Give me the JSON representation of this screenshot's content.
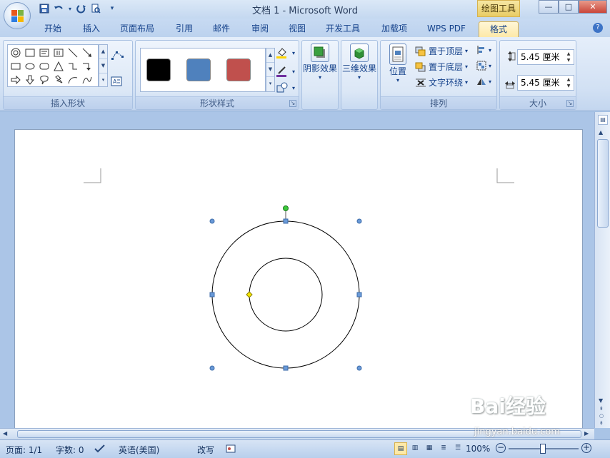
{
  "titlebar": {
    "title": "文档 1 - Microsoft Word",
    "context_tab": "绘图工具",
    "minimize": "—",
    "maximize": "□",
    "close": "✕"
  },
  "qat": {
    "save_icon": "save-icon",
    "undo_icon": "undo-icon",
    "redo_icon": "redo-icon",
    "print_preview_icon": "print-preview-icon",
    "customize_icon": "chevron-down-icon"
  },
  "tabs": [
    {
      "label": "开始"
    },
    {
      "label": "插入"
    },
    {
      "label": "页面布局"
    },
    {
      "label": "引用"
    },
    {
      "label": "邮件"
    },
    {
      "label": "审阅"
    },
    {
      "label": "视图"
    },
    {
      "label": "开发工具"
    },
    {
      "label": "加载项"
    },
    {
      "label": "WPS PDF"
    },
    {
      "label": "格式"
    }
  ],
  "active_tab": "格式",
  "ribbon": {
    "insert_shapes": {
      "label": "插入形状"
    },
    "shape_styles": {
      "label": "形状样式",
      "swatches": [
        "#000000",
        "#4f81bd",
        "#c0504d"
      ]
    },
    "shadow": {
      "label": "阴影效果"
    },
    "threed": {
      "label": "三维效果"
    },
    "arrange": {
      "label": "排列",
      "position": "位置",
      "bring_front": "置于顶层",
      "send_back": "置于底层",
      "text_wrap": "文字环绕"
    },
    "size": {
      "label": "大小",
      "height": "5.45 厘米",
      "width": "5.45 厘米"
    }
  },
  "status": {
    "page": "页面: 1/1",
    "words": "字数: 0",
    "language": "英语(美国)",
    "overwrite": "改写",
    "zoom": "100%"
  },
  "watermark": {
    "text": "Bai经验",
    "url": "jingyan.baidu.com"
  }
}
